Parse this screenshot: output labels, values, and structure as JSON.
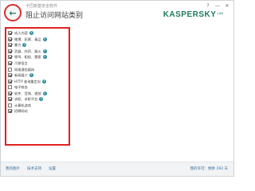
{
  "header": {
    "app_subtitle": "卡巴斯基安全软件",
    "title": "阻止访问网站类别",
    "back_icon": "back-arrow-icon",
    "controls": {
      "help": "?",
      "minimize": "—",
      "close": "✕"
    },
    "brand": {
      "name": "KASPERSKY",
      "badge": "LAB"
    }
  },
  "colors": {
    "highlight_border": "#e02020",
    "brand": "#1f7a5c",
    "info_icon": "#2e8fa0",
    "link": "#3370a0"
  },
  "categories": [
    {
      "label": "成人内容",
      "checked": true,
      "info": true
    },
    {
      "label": "赌博、彩票、毒品",
      "checked": true,
      "info": true
    },
    {
      "label": "暴力",
      "checked": true,
      "info": true
    },
    {
      "label": "武器、炸药、烟火",
      "checked": true,
      "info": true
    },
    {
      "label": "辱骂、粗俗、猥亵",
      "checked": true,
      "info": true
    },
    {
      "label": "污秽语言",
      "checked": true,
      "info": false
    },
    {
      "label": "网络通信媒体",
      "checked": false,
      "info": false
    },
    {
      "label": "新闻媒介",
      "checked": true,
      "info": true
    },
    {
      "label": "HTTP 查询重定向",
      "checked": true,
      "info": true
    },
    {
      "label": "电子商务",
      "checked": false,
      "info": false
    },
    {
      "label": "软件、音频、视频",
      "checked": true,
      "info": true
    },
    {
      "label": "求职、求职平台",
      "checked": true,
      "info": true
    },
    {
      "label": "计算机游戏",
      "checked": false,
      "info": false
    },
    {
      "label": "招聘网站",
      "checked": true,
      "info": false
    }
  ],
  "footer": {
    "links": [
      "我的图片",
      "技术支持",
      "设置"
    ],
    "license": "我的许可：剩余 292 天"
  }
}
